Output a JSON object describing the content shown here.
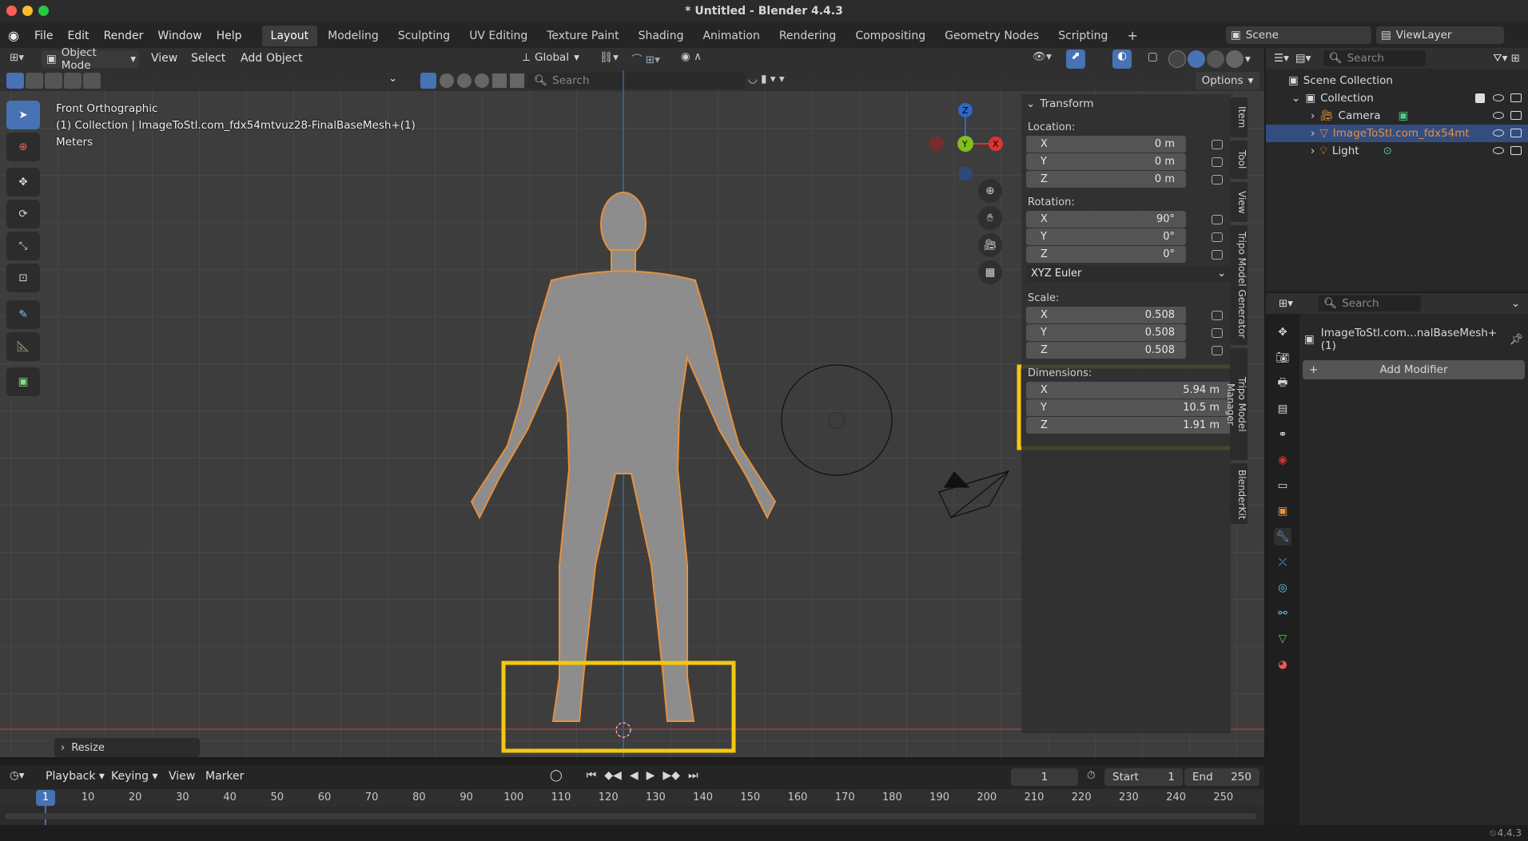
{
  "window": {
    "title": "* Untitled - Blender 4.4.3"
  },
  "menu": [
    "File",
    "Edit",
    "Render",
    "Window",
    "Help"
  ],
  "workspaces": [
    {
      "label": "Layout",
      "active": true
    },
    {
      "label": "Modeling"
    },
    {
      "label": "Sculpting"
    },
    {
      "label": "UV Editing"
    },
    {
      "label": "Texture Paint"
    },
    {
      "label": "Shading"
    },
    {
      "label": "Animation"
    },
    {
      "label": "Rendering"
    },
    {
      "label": "Compositing"
    },
    {
      "label": "Geometry Nodes"
    },
    {
      "label": "Scripting"
    }
  ],
  "scene": {
    "name": "Scene",
    "view_layer": "ViewLayer"
  },
  "viewport_header": {
    "mode": "Object Mode",
    "menus": [
      "View",
      "Select",
      "Add",
      "Object"
    ],
    "orientation": "Global",
    "search_placeholder": "Search",
    "options": "Options"
  },
  "viewport": {
    "overlay_line1": "Front Orthographic",
    "overlay_line2": "(1) Collection | ImageToStl.com_fdx54mtvuz28-FinalBaseMesh+(1)",
    "overlay_line3": "Meters",
    "gizmo_z": "Z",
    "gizmo_y": "Y",
    "gizmo_x": "X",
    "last_op": "Resize"
  },
  "transform": {
    "title": "Transform",
    "location_label": "Location:",
    "location": [
      {
        "axis": "X",
        "value": "0 m"
      },
      {
        "axis": "Y",
        "value": "0 m"
      },
      {
        "axis": "Z",
        "value": "0 m"
      }
    ],
    "rotation_label": "Rotation:",
    "rotation": [
      {
        "axis": "X",
        "value": "90°"
      },
      {
        "axis": "Y",
        "value": "0°"
      },
      {
        "axis": "Z",
        "value": "0°"
      }
    ],
    "rotation_mode": "XYZ Euler",
    "scale_label": "Scale:",
    "scale": [
      {
        "axis": "X",
        "value": "0.508"
      },
      {
        "axis": "Y",
        "value": "0.508"
      },
      {
        "axis": "Z",
        "value": "0.508"
      }
    ],
    "dimensions_label": "Dimensions:",
    "dimensions": [
      {
        "axis": "X",
        "value": "5.94 m"
      },
      {
        "axis": "Y",
        "value": "10.5 m"
      },
      {
        "axis": "Z",
        "value": "1.91 m"
      }
    ]
  },
  "side_tabs": [
    "Item",
    "Tool",
    "View",
    "Tripo Model Generator",
    "Tripo Model Manager",
    "BlenderKit"
  ],
  "outliner": {
    "search_placeholder": "Search",
    "root": "Scene Collection",
    "collection": "Collection",
    "items": [
      {
        "label": "Camera"
      },
      {
        "label": "ImageToStl.com_fdx54mt",
        "selected": true
      },
      {
        "label": "Light"
      }
    ]
  },
  "properties": {
    "search_placeholder": "Search",
    "object_name": "ImageToStl.com...nalBaseMesh+(1)",
    "add_modifier": "Add Modifier"
  },
  "timeline": {
    "menus": [
      "Playback",
      "Keying",
      "View",
      "Marker"
    ],
    "current_frame": "1",
    "start_label": "Start",
    "start": "1",
    "end_label": "End",
    "end": "250",
    "ruler": [
      "1",
      "10",
      "20",
      "30",
      "40",
      "50",
      "60",
      "70",
      "80",
      "90",
      "100",
      "110",
      "120",
      "130",
      "140",
      "150",
      "160",
      "170",
      "180",
      "190",
      "200",
      "210",
      "220",
      "230",
      "240",
      "250"
    ]
  },
  "status": {
    "version": "4.4.3"
  },
  "colors": {
    "accent": "#4772b3",
    "selection": "#e8903a",
    "highlight_box": "#f2c811"
  }
}
